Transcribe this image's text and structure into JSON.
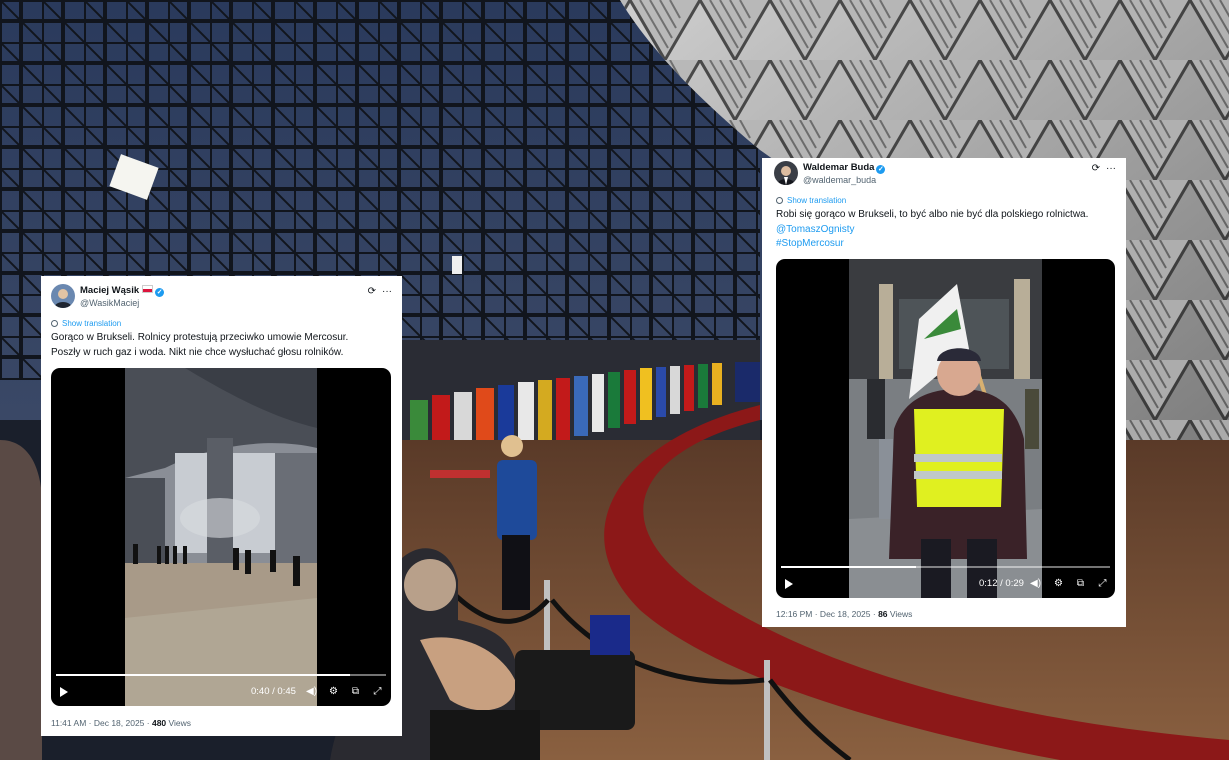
{
  "tweet_left": {
    "author_name": "Maciej Wąsik",
    "author_handle": "@WasikMaciej",
    "translate_label": "Show translation",
    "text_line1": "Gorąco w Brukseli. Rolnicy protestują przeciwko umowie Mercosur.",
    "text_line2": "Poszły w ruch gaz i woda. Nikt nie chce wysłuchać głosu rolników.",
    "video_time": "0:40 / 0:45",
    "video_progress": 0.89,
    "timestamp": "11:41 AM · Dec 18, 2025 · ",
    "views_count": "480",
    "views_label": " Views",
    "more_icon": "···"
  },
  "tweet_right": {
    "author_name": "Waldemar Buda",
    "author_handle": "@waldemar_buda",
    "translate_label": "Show translation",
    "text_line1": "Robi się gorąco w Brukseli, to być albo nie być dla polskiego rolnictwa.",
    "mention": "@TomaszOgnisty",
    "hashtag": "#StopMercosur",
    "video_time": "0:12 / 0:29",
    "video_progress": 0.41,
    "timestamp": "12:16 PM · Dec 18, 2025 · ",
    "views_count": "86",
    "views_label": " Views",
    "more_icon": "···"
  },
  "colors": {
    "link": "#1d9bf0",
    "secondary_text": "#536471",
    "primary_text": "#0f1419",
    "carpet": "#8c1818"
  }
}
